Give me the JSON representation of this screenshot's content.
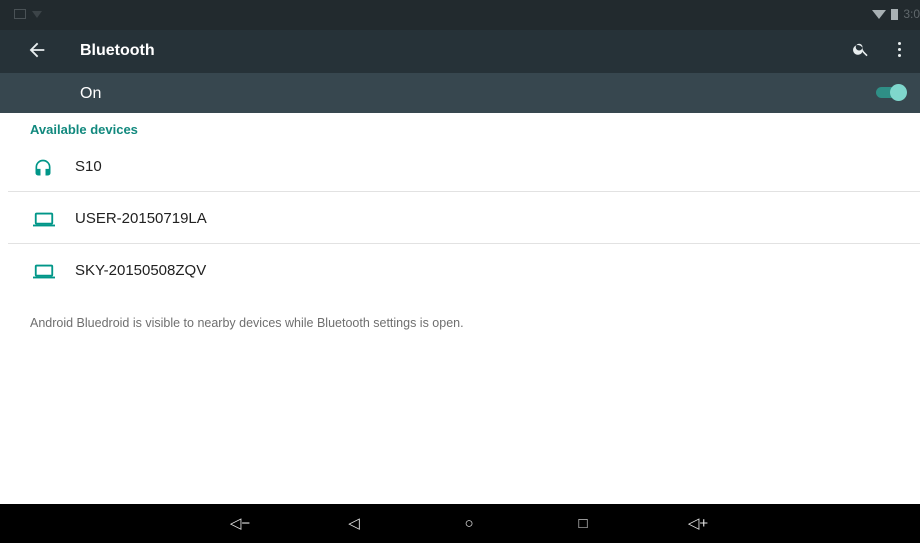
{
  "status_bar": {
    "time": "3:0"
  },
  "toolbar": {
    "back_icon": "arrow-left-icon",
    "title": "Bluetooth",
    "search_icon": "search-icon",
    "menu_icon": "more-vert-icon"
  },
  "switch_bar": {
    "label": "On",
    "enabled": true,
    "accent": "#80cbc4"
  },
  "section": {
    "title": "Available devices",
    "accent": "#009688"
  },
  "devices": [
    {
      "name": "S10",
      "icon": "headset-icon"
    },
    {
      "name": "USER-20150719LA",
      "icon": "laptop-icon"
    },
    {
      "name": "SKY-20150508ZQV",
      "icon": "laptop-icon"
    }
  ],
  "footer_note": "Android Bluedroid is visible to nearby devices while Bluetooth settings is open.",
  "nav_bar": {
    "volume_down_label": "◁−",
    "back_label": "◁",
    "home_label": "○",
    "recents_label": "□",
    "volume_up_label": "◁+"
  }
}
